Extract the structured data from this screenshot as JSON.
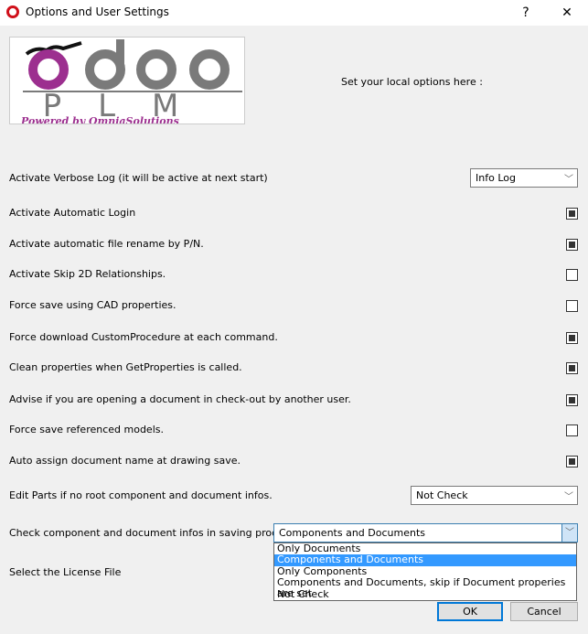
{
  "window": {
    "title": "Options and User Settings",
    "help": "?",
    "close": "✕"
  },
  "logo": {
    "text_top": "odoo",
    "text_mid": "PLM",
    "text_bottom": "Powered by OmniaSolutions",
    "colors": {
      "o": "#9c2f8f",
      "gray": "#7a7a7a"
    }
  },
  "intro": "Set your local options here :",
  "verbose": {
    "label": "Activate Verbose Log (it will be active at next start)",
    "value": "Info Log"
  },
  "checkboxes": [
    {
      "label": "Activate Automatic Login",
      "checked": true
    },
    {
      "label": "Activate automatic file rename by P/N.",
      "checked": true
    },
    {
      "label": "Activate Skip 2D Relationships.",
      "checked": false
    },
    {
      "label": "Force save using CAD properties.",
      "checked": false
    },
    {
      "label": "Force download CustomProcedure at each command.",
      "checked": true
    },
    {
      "label": "Clean properties when GetProperties is called.",
      "checked": true
    },
    {
      "label": "Advise if you are opening a document in check-out by another user.",
      "checked": true
    },
    {
      "label": "Force save referenced models.",
      "checked": false
    },
    {
      "label": "Auto assign document name at drawing save.",
      "checked": true
    }
  ],
  "edit_parts": {
    "label": "Edit Parts if no root component and document infos.",
    "value": "Not Check"
  },
  "check_infos": {
    "label": "Check component and document infos in saving procedure.",
    "value": "Components and Documents",
    "options": [
      "Only Documents",
      "Components and Documents",
      "Only Components",
      "Components and Documents, skip if Document properies are set",
      "Not Check"
    ],
    "highlighted": 1
  },
  "license": {
    "label": "Select the License File"
  },
  "buttons": {
    "ok": "OK",
    "cancel": "Cancel"
  }
}
